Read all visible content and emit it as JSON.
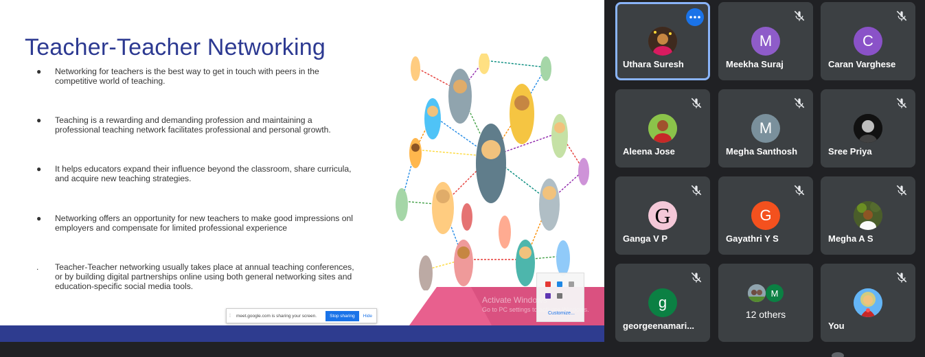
{
  "slide": {
    "title": "Teacher-Teacher Networking",
    "bullets": [
      {
        "marker": "●",
        "text": "Networking for teachers is the best way to get in touch with peers in the competitive world of teaching."
      },
      {
        "marker": "●",
        "text": "Teaching is a rewarding and demanding profession and maintaining a professional teaching network facilitates professional and personal growth."
      },
      {
        "marker": "●",
        "text": "It helps educators expand their influence beyond the classroom, share curricula, and acquire new teaching strategies."
      },
      {
        "marker": "●",
        "text": "Networking offers an opportunity for new teachers to make good impressions onl employers and compensate for limited professional experience"
      },
      {
        "marker": ".",
        "text": "Teacher-Teacher networking usually takes place at annual teaching conferences, or by building digital partnerships online using both general networking sites and education-specific social media tools."
      }
    ]
  },
  "share_bar": {
    "message": "meet.google.com is sharing your screen.",
    "stop_label": "Stop sharing",
    "hide_label": "Hide"
  },
  "watermark": {
    "line1": "Activate Windows",
    "line2": "Go to PC settings to activate Windows."
  },
  "tray": {
    "customize_label": "Customize..."
  },
  "participants": [
    {
      "name": "Uthara Suresh",
      "avatar_type": "photo",
      "photo_color": "#6a3b2a",
      "active": true
    },
    {
      "name": "Meekha Suraj",
      "initial": "M",
      "color": "#8e5cc9",
      "muted": true
    },
    {
      "name": "Caran Varghese",
      "initial": "C",
      "color": "#8a52c8",
      "muted": true
    },
    {
      "name": "Aleena Jose",
      "avatar_type": "photo",
      "photo_color": "#7da05c",
      "muted": true
    },
    {
      "name": "Megha Santhosh",
      "initial": "M",
      "color": "#7a909c",
      "muted": true
    },
    {
      "name": "Sree Priya",
      "avatar_type": "photo",
      "photo_color": "#111111",
      "muted": true
    },
    {
      "name": "Ganga V P",
      "initial": "G",
      "color": "#f4c8d8",
      "text_color": "#000000",
      "muted": true
    },
    {
      "name": "Gayathri Y S",
      "initial": "G",
      "color": "#f4511e",
      "muted": true
    },
    {
      "name": "Megha A S",
      "avatar_type": "photo",
      "photo_color": "#5c6e3a",
      "muted": true
    },
    {
      "name": "georgeenamari...",
      "initial": "g",
      "color": "#0b8043",
      "muted": true
    },
    {
      "name": "You",
      "avatar_type": "photo",
      "photo_color": "#4a8fc0",
      "muted": true
    }
  ],
  "others": {
    "label": "12 others",
    "mini_initial": "M",
    "mini_color": "#0b8043"
  },
  "colors": {
    "background": "#202124",
    "tile": "#3c4043",
    "active_border": "#8ab4f8",
    "accent_blue": "#1a73e8",
    "slide_title": "#2c3991",
    "slide_footer": "#2e3c8f"
  }
}
